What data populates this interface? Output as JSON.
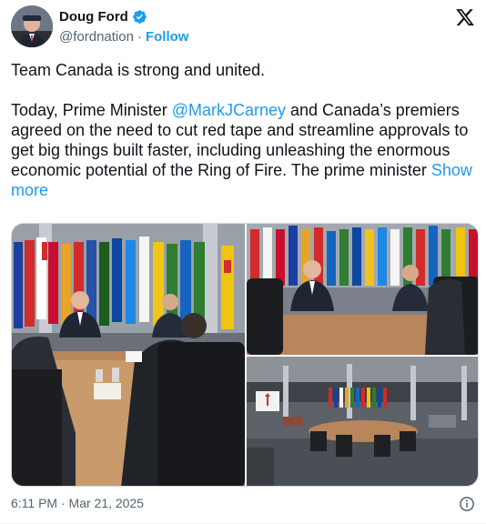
{
  "author": {
    "name": "Doug Ford",
    "handle": "@fordnation",
    "separator": "·",
    "follow_label": "Follow"
  },
  "tweet": {
    "line1": "Team Canada is strong and united.",
    "para2_before": "Today, Prime Minister ",
    "mention": "@MarkJCarney",
    "para2_after": " and Canada’s premiers agreed on the need to cut red tape and streamline approvals to get big things built faster, including unleashing the enormous economic potential of the Ring of Fire. The prime minister ",
    "show_more": "Show more"
  },
  "footer": {
    "timestamp": "6:11 PM · Mar 21, 2025"
  },
  "colors": {
    "accent": "#1d9bf0",
    "text": "#0f1419",
    "muted": "#536471"
  },
  "icons": [
    "verified-badge-icon",
    "x-logo-icon",
    "info-icon"
  ]
}
